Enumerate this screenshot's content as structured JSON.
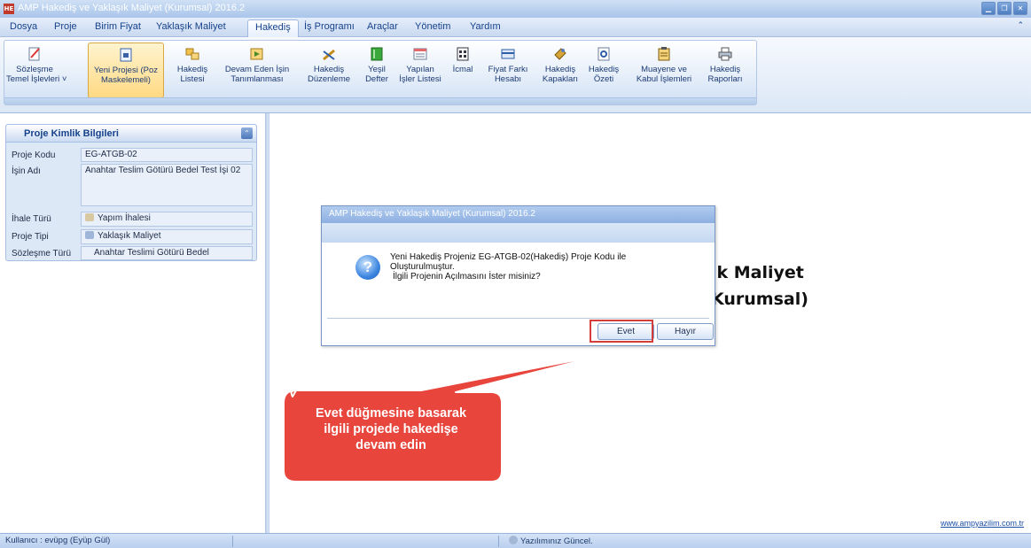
{
  "window": {
    "title": "AMP Hakediş ve Yaklaşık Maliyet (Kurumsal) 2016.2",
    "app_icon": "HE"
  },
  "menu": {
    "tabs": [
      {
        "label": "Dosya"
      },
      {
        "label": "Proje"
      },
      {
        "label": "Birim Fiyat"
      },
      {
        "label": "Yaklaşık Maliyet"
      },
      {
        "label": "Hakediş"
      },
      {
        "label": "İş Programı"
      },
      {
        "label": "Araçlar"
      },
      {
        "label": "Yönetim"
      },
      {
        "label": "Yardım"
      }
    ],
    "active": "Hakediş"
  },
  "ribbon": {
    "buttons": [
      {
        "line1": "Sözleşme",
        "line2": "Temel İşlevleri ˅",
        "icon": "edit-icon"
      },
      {
        "line1": "Yeni Projesi (Poz",
        "line2": "Maskelemeli)",
        "icon": "new-project-icon"
      },
      {
        "line1": "Hakediş",
        "line2": "Listesi",
        "icon": "list-icon"
      },
      {
        "line1": "Devam Eden İşin",
        "line2": "Tanımlanması",
        "icon": "continue-icon"
      },
      {
        "line1": "Hakediş",
        "line2": "Düzenleme",
        "icon": "tools-icon"
      },
      {
        "line1": "Yeşil",
        "line2": "Defter",
        "icon": "book-icon"
      },
      {
        "line1": "Yapılan",
        "line2": "İşler Listesi",
        "icon": "works-list-icon"
      },
      {
        "line1": "İcmal",
        "line2": "",
        "icon": "summary-icon"
      },
      {
        "line1": "Fiyat Farkı",
        "line2": "Hesabı",
        "icon": "calculator-icon"
      },
      {
        "line1": "Hakediş",
        "line2": "Kapakları",
        "icon": "cover-icon"
      },
      {
        "line1": "Hakediş",
        "line2": "Özeti",
        "icon": "preview-icon"
      },
      {
        "line1": "Muayene ve",
        "line2": "Kabul İşlemleri",
        "icon": "clipboard-icon"
      },
      {
        "line1": "Hakediş",
        "line2": "Raporları",
        "icon": "printer-icon"
      }
    ]
  },
  "project_info": {
    "header": "Proje Kimlik Bilgileri",
    "fields": [
      {
        "label": "Proje Kodu",
        "value": "EG-ATGB-02"
      },
      {
        "label": "İşin Adı",
        "value": "Anahtar Teslim Götürü Bedel Test İşi 02"
      },
      {
        "label": "İhale Türü",
        "value": "Yapım İhalesi"
      },
      {
        "label": "Proje Tipi",
        "value": "Yaklaşık Maliyet"
      },
      {
        "label": "Sözleşme Türü",
        "value": "Anahtar Teslimi Götürü Bedel"
      }
    ]
  },
  "background_text": {
    "line1": "ık Maliyet",
    "line2": "Kurumsal)"
  },
  "website": "www.ampyazilim.com.tr",
  "dialog": {
    "title": "AMP Hakediş ve Yaklaşık Maliyet (Kurumsal) 2016.2",
    "message_line1": "Yeni Hakediş Projeniz EG-ATGB-02(Hakediş) Proje Kodu ile",
    "message_line2": "Oluşturulmuştur.",
    "message_line3": "İlgili Projenin Açılmasını İster misiniz?",
    "yes_label": "Evet",
    "no_label": "Hayır"
  },
  "callout": {
    "line1": "Evet düğmesine basarak",
    "line2": "ilgili projede hakedişe",
    "line3": "devam edin",
    "color": "#e8453c"
  },
  "status": {
    "user": "Kullanıcı : evüpg  (Eyüp Gül)",
    "update": "Yazılımınız Güncel."
  }
}
